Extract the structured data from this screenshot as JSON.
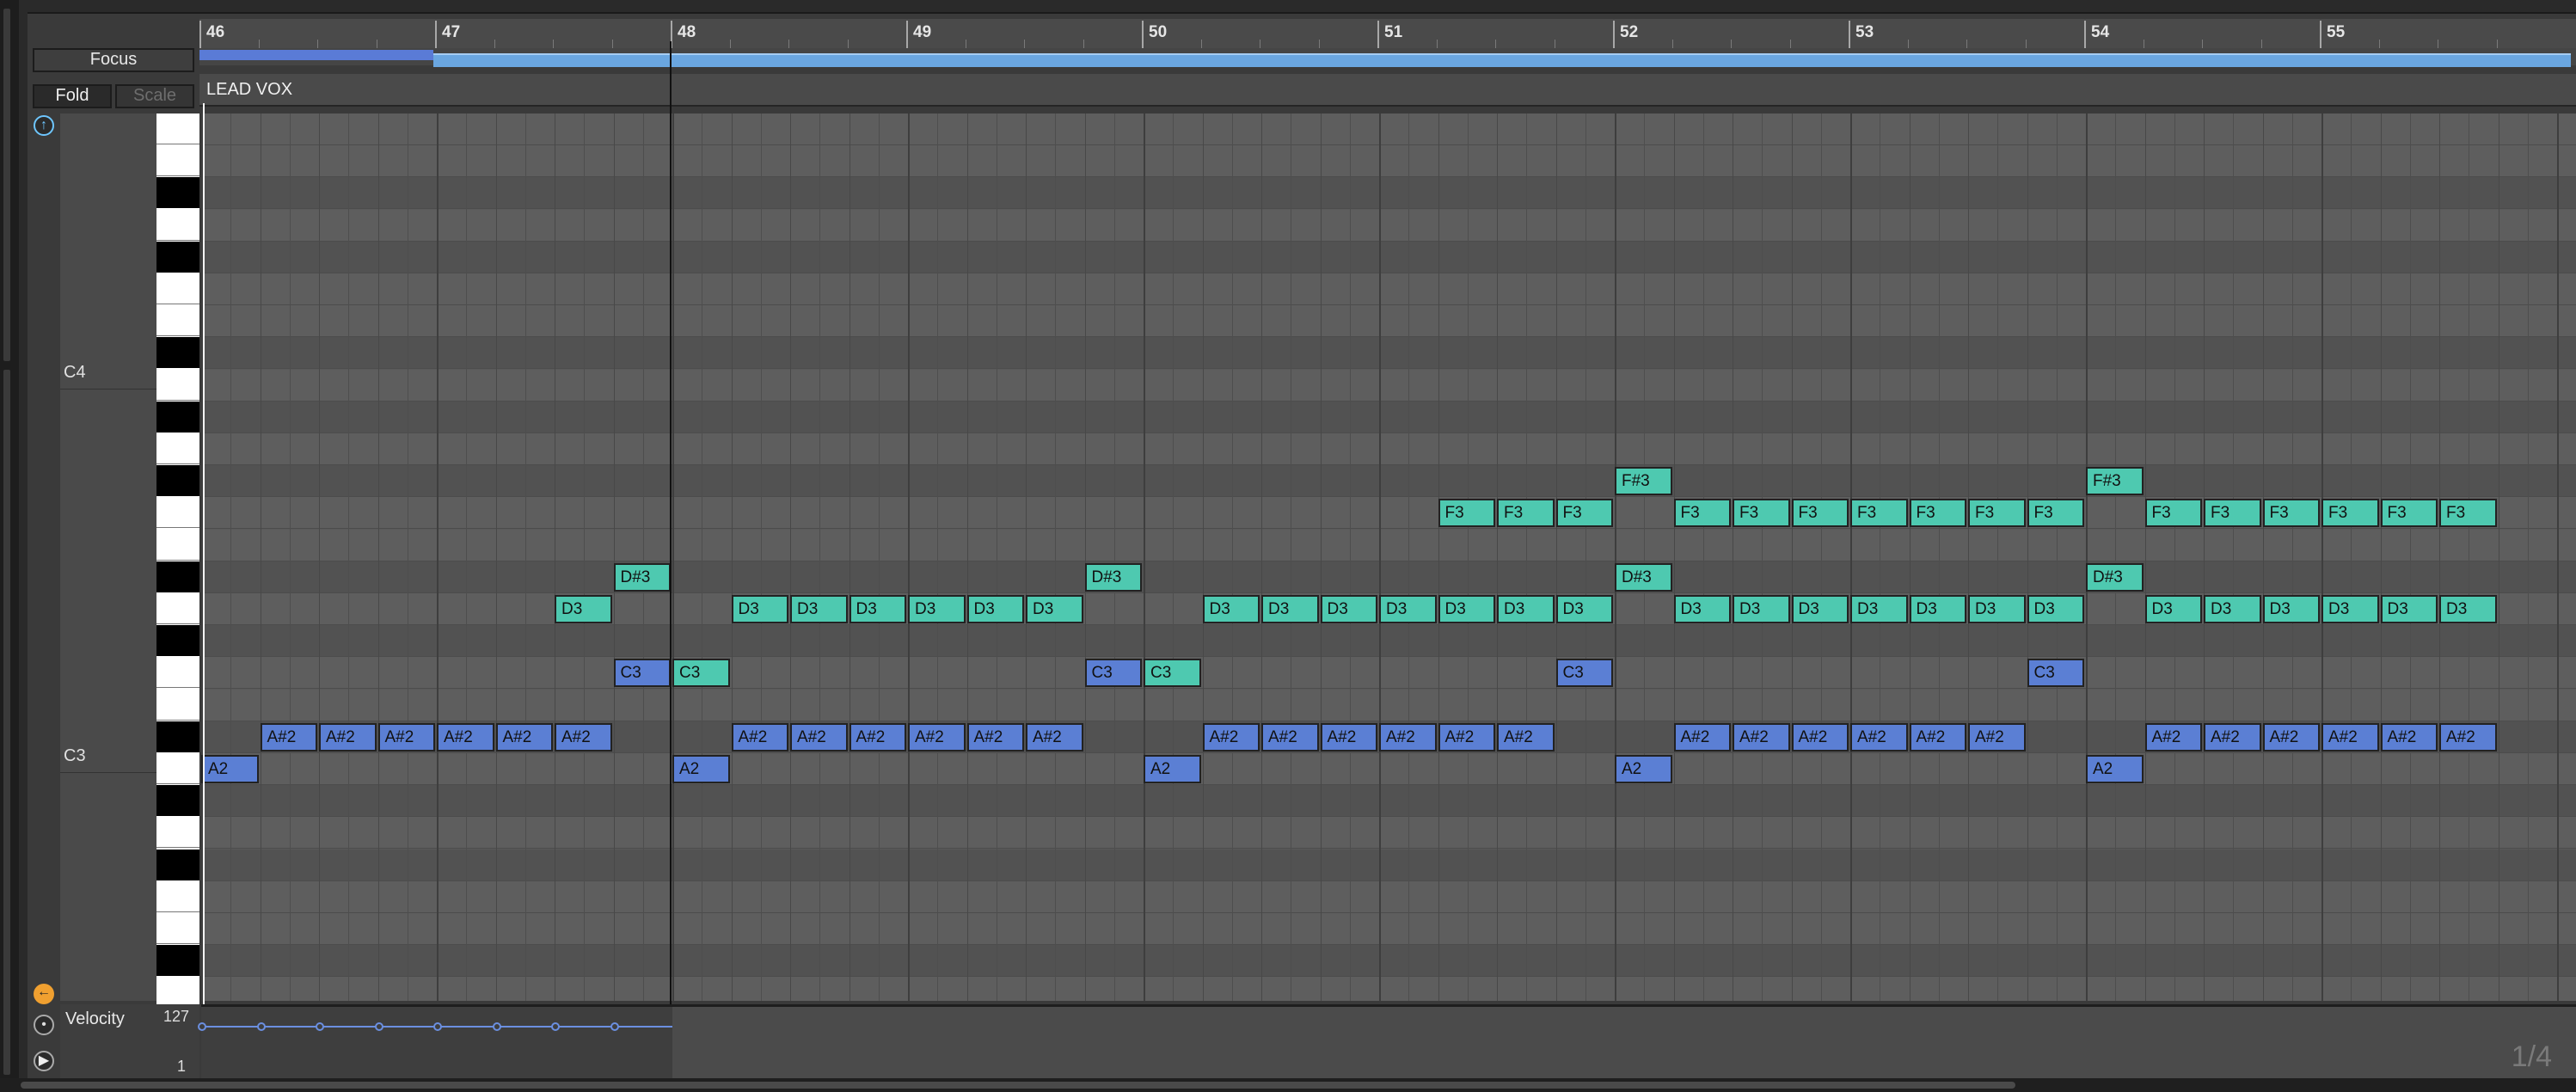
{
  "header": {
    "focus_label": "Focus",
    "fold_label": "Fold",
    "scale_label": "Scale"
  },
  "ruler": {
    "bars": [
      "46",
      "47",
      "48",
      "49",
      "50",
      "51",
      "52",
      "53",
      "54",
      "55"
    ]
  },
  "clip": {
    "name": "LEAD VOX"
  },
  "keyboard": {
    "octave_labels": [
      "C4",
      "C3"
    ]
  },
  "notes": [
    {
      "pitch": "A2",
      "start": 0.0,
      "dur": 0.25
    },
    {
      "pitch": "A#2",
      "start": 0.25,
      "dur": 0.25
    },
    {
      "pitch": "A#2",
      "start": 0.5,
      "dur": 0.25
    },
    {
      "pitch": "A#2",
      "start": 0.75,
      "dur": 0.25
    },
    {
      "pitch": "A#2",
      "start": 1.0,
      "dur": 0.25
    },
    {
      "pitch": "A#2",
      "start": 1.25,
      "dur": 0.25
    },
    {
      "pitch": "A#2",
      "start": 1.5,
      "dur": 0.25
    },
    {
      "pitch": "D3",
      "start": 1.5,
      "dur": 0.25
    },
    {
      "pitch": "C3",
      "start": 1.75,
      "dur": 0.25
    },
    {
      "pitch": "D#3",
      "start": 1.75,
      "dur": 0.25
    },
    {
      "pitch": "A2",
      "start": 2.0,
      "dur": 0.25
    },
    {
      "pitch": "C3",
      "start": 2.0,
      "dur": 0.25
    },
    {
      "pitch": "A#2",
      "start": 2.25,
      "dur": 0.25
    },
    {
      "pitch": "D3",
      "start": 2.25,
      "dur": 0.25
    },
    {
      "pitch": "A#2",
      "start": 2.5,
      "dur": 0.25
    },
    {
      "pitch": "D3",
      "start": 2.5,
      "dur": 0.25
    },
    {
      "pitch": "A#2",
      "start": 2.75,
      "dur": 0.25
    },
    {
      "pitch": "D3",
      "start": 2.75,
      "dur": 0.25
    },
    {
      "pitch": "A#2",
      "start": 3.0,
      "dur": 0.25
    },
    {
      "pitch": "D3",
      "start": 3.0,
      "dur": 0.25
    },
    {
      "pitch": "A#2",
      "start": 3.25,
      "dur": 0.25
    },
    {
      "pitch": "D3",
      "start": 3.25,
      "dur": 0.25
    },
    {
      "pitch": "A#2",
      "start": 3.5,
      "dur": 0.25
    },
    {
      "pitch": "D3",
      "start": 3.5,
      "dur": 0.25
    },
    {
      "pitch": "C3",
      "start": 3.75,
      "dur": 0.25
    },
    {
      "pitch": "D#3",
      "start": 3.75,
      "dur": 0.25
    },
    {
      "pitch": "A2",
      "start": 4.0,
      "dur": 0.25
    },
    {
      "pitch": "C3",
      "start": 4.0,
      "dur": 0.25
    },
    {
      "pitch": "A#2",
      "start": 4.25,
      "dur": 0.25
    },
    {
      "pitch": "D3",
      "start": 4.25,
      "dur": 0.25
    },
    {
      "pitch": "A#2",
      "start": 4.5,
      "dur": 0.25
    },
    {
      "pitch": "D3",
      "start": 4.5,
      "dur": 0.25
    },
    {
      "pitch": "A#2",
      "start": 4.75,
      "dur": 0.25
    },
    {
      "pitch": "D3",
      "start": 4.75,
      "dur": 0.25
    },
    {
      "pitch": "A#2",
      "start": 5.0,
      "dur": 0.25
    },
    {
      "pitch": "D3",
      "start": 5.0,
      "dur": 0.25
    },
    {
      "pitch": "A#2",
      "start": 5.25,
      "dur": 0.25
    },
    {
      "pitch": "D3",
      "start": 5.25,
      "dur": 0.25
    },
    {
      "pitch": "F3",
      "start": 5.25,
      "dur": 0.25
    },
    {
      "pitch": "A#2",
      "start": 5.5,
      "dur": 0.25
    },
    {
      "pitch": "D3",
      "start": 5.5,
      "dur": 0.25
    },
    {
      "pitch": "F3",
      "start": 5.5,
      "dur": 0.25
    },
    {
      "pitch": "C3",
      "start": 5.75,
      "dur": 0.25
    },
    {
      "pitch": "D3",
      "start": 5.75,
      "dur": 0.25
    },
    {
      "pitch": "F3",
      "start": 5.75,
      "dur": 0.25
    },
    {
      "pitch": "A2",
      "start": 6.0,
      "dur": 0.25
    },
    {
      "pitch": "D#3",
      "start": 6.0,
      "dur": 0.25
    },
    {
      "pitch": "F#3",
      "start": 6.0,
      "dur": 0.25
    },
    {
      "pitch": "A#2",
      "start": 6.25,
      "dur": 0.25
    },
    {
      "pitch": "D3",
      "start": 6.25,
      "dur": 0.25
    },
    {
      "pitch": "F3",
      "start": 6.25,
      "dur": 0.25
    },
    {
      "pitch": "A#2",
      "start": 6.5,
      "dur": 0.25
    },
    {
      "pitch": "D3",
      "start": 6.5,
      "dur": 0.25
    },
    {
      "pitch": "F3",
      "start": 6.5,
      "dur": 0.25
    },
    {
      "pitch": "A#2",
      "start": 6.75,
      "dur": 0.25
    },
    {
      "pitch": "D3",
      "start": 6.75,
      "dur": 0.25
    },
    {
      "pitch": "F3",
      "start": 6.75,
      "dur": 0.25
    },
    {
      "pitch": "A#2",
      "start": 7.0,
      "dur": 0.25
    },
    {
      "pitch": "D3",
      "start": 7.0,
      "dur": 0.25
    },
    {
      "pitch": "F3",
      "start": 7.0,
      "dur": 0.25
    },
    {
      "pitch": "A#2",
      "start": 7.25,
      "dur": 0.25
    },
    {
      "pitch": "D3",
      "start": 7.25,
      "dur": 0.25
    },
    {
      "pitch": "F3",
      "start": 7.25,
      "dur": 0.25
    },
    {
      "pitch": "A#2",
      "start": 7.5,
      "dur": 0.25
    },
    {
      "pitch": "D3",
      "start": 7.5,
      "dur": 0.25
    },
    {
      "pitch": "F3",
      "start": 7.5,
      "dur": 0.25
    },
    {
      "pitch": "C3",
      "start": 7.75,
      "dur": 0.25
    },
    {
      "pitch": "D3",
      "start": 7.75,
      "dur": 0.25
    },
    {
      "pitch": "F3",
      "start": 7.75,
      "dur": 0.25
    },
    {
      "pitch": "A2",
      "start": 8.0,
      "dur": 0.25
    },
    {
      "pitch": "D#3",
      "start": 8.0,
      "dur": 0.25
    },
    {
      "pitch": "F#3",
      "start": 8.0,
      "dur": 0.25
    },
    {
      "pitch": "A#2",
      "start": 8.25,
      "dur": 0.25
    },
    {
      "pitch": "D3",
      "start": 8.25,
      "dur": 0.25
    },
    {
      "pitch": "F3",
      "start": 8.25,
      "dur": 0.25
    },
    {
      "pitch": "A#2",
      "start": 8.5,
      "dur": 0.25
    },
    {
      "pitch": "D3",
      "start": 8.5,
      "dur": 0.25
    },
    {
      "pitch": "F3",
      "start": 8.5,
      "dur": 0.25
    },
    {
      "pitch": "A#2",
      "start": 8.75,
      "dur": 0.25
    },
    {
      "pitch": "D3",
      "start": 8.75,
      "dur": 0.25
    },
    {
      "pitch": "F3",
      "start": 8.75,
      "dur": 0.25
    },
    {
      "pitch": "A#2",
      "start": 9.0,
      "dur": 0.25
    },
    {
      "pitch": "D3",
      "start": 9.0,
      "dur": 0.25
    },
    {
      "pitch": "F3",
      "start": 9.0,
      "dur": 0.25
    },
    {
      "pitch": "A#2",
      "start": 9.25,
      "dur": 0.25
    },
    {
      "pitch": "D3",
      "start": 9.25,
      "dur": 0.25
    },
    {
      "pitch": "F3",
      "start": 9.25,
      "dur": 0.25
    },
    {
      "pitch": "A#2",
      "start": 9.5,
      "dur": 0.25
    },
    {
      "pitch": "D3",
      "start": 9.5,
      "dur": 0.25
    },
    {
      "pitch": "F3",
      "start": 9.5,
      "dur": 0.25
    }
  ],
  "velocity": {
    "label": "Velocity",
    "max_label": "127",
    "min_label": "1",
    "values": [
      127,
      127,
      127,
      127,
      127,
      127,
      127,
      127
    ]
  },
  "page_indicator": "1/4",
  "colors": {
    "note_teal": "#4ec9b0",
    "note_blue": "#5b7fd4",
    "loop_bar": "#6aa6e0"
  }
}
